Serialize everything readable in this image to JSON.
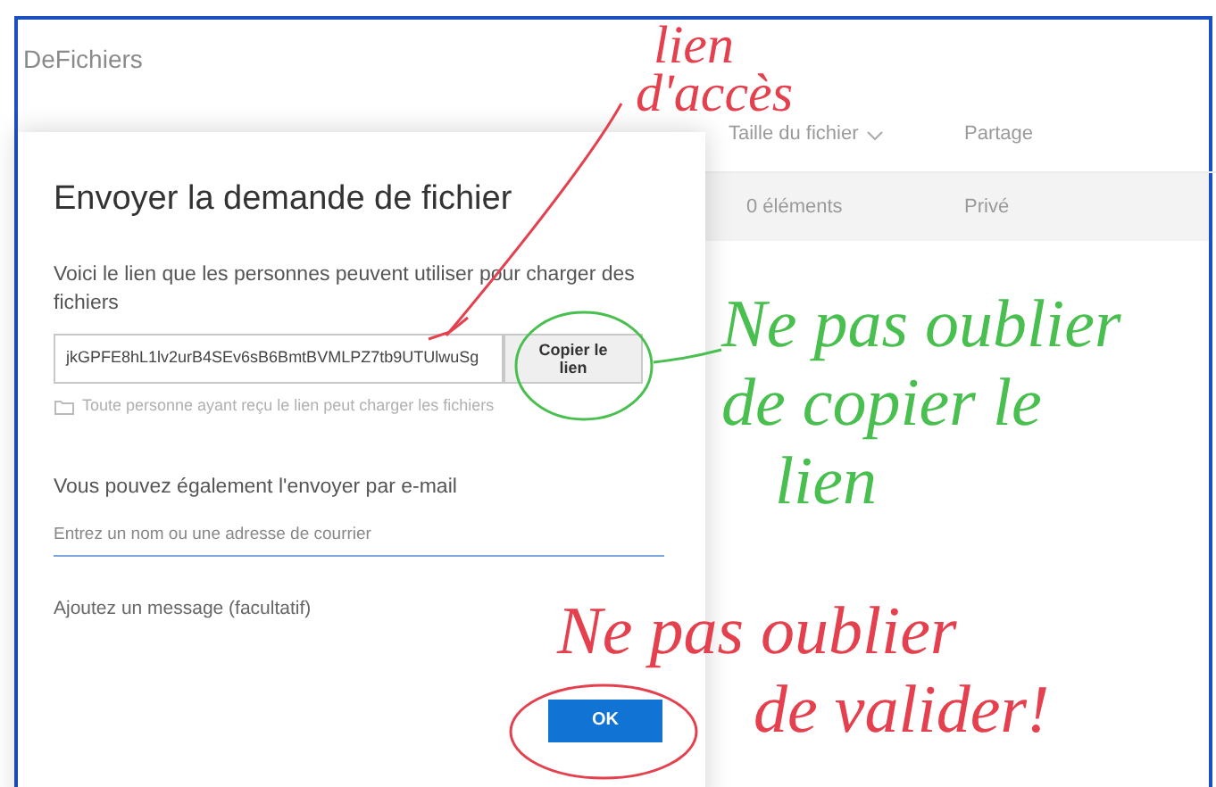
{
  "app": {
    "title": "DeFichiers"
  },
  "file_list": {
    "columns": [
      "Taille du fichier",
      "Partage"
    ],
    "rows": [
      {
        "size": "0 éléments",
        "sharing": "Privé"
      }
    ]
  },
  "dialog": {
    "title": "Envoyer la demande de fichier",
    "link_label": "Voici le lien que les personnes peuvent utiliser pour charger des fichiers",
    "link_value": "jkGPFE8hL1lv2urB4SEv6sB6BmtBVMLPZ7tb9UTUlwuSg",
    "copy_button": "Copier le lien",
    "link_note": "Toute personne ayant reçu le lien peut charger les fichiers",
    "email_label": "Vous pouvez également l'envoyer par e-mail",
    "email_placeholder": "Entrez un nom ou une adresse de courrier",
    "message_label": "Ajoutez un message (facultatif)",
    "ok_button": "OK"
  },
  "annotations": [
    {
      "lines": [
        "lien",
        "d'accès"
      ],
      "color": "#e5404e"
    },
    {
      "lines": [
        "Ne pas oublier",
        "de copier le",
        "lien"
      ],
      "color": "#49bf4f"
    },
    {
      "lines": [
        "Ne pas oublier",
        "de valider!"
      ],
      "color": "#e5404e"
    }
  ]
}
